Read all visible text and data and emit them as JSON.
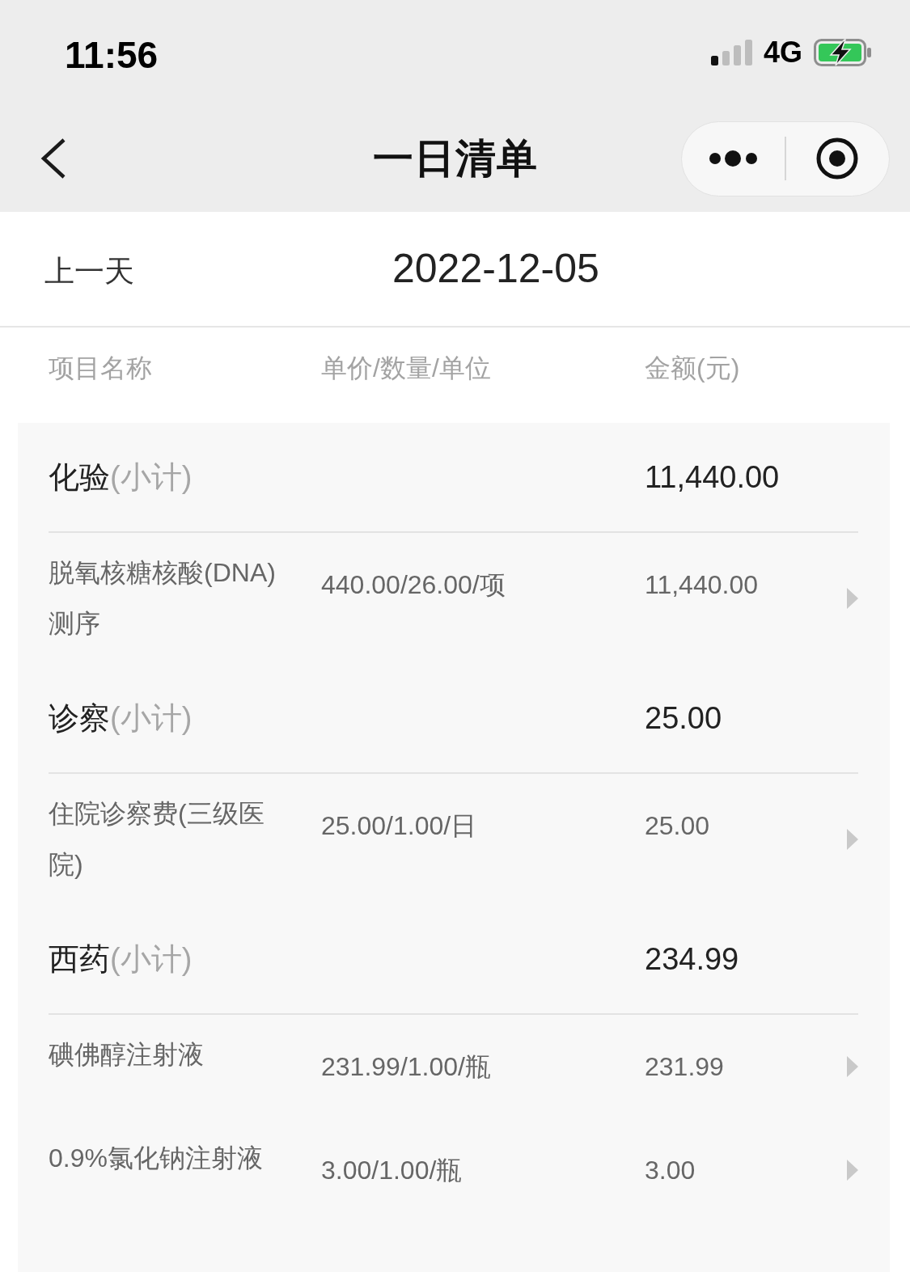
{
  "status_bar": {
    "time": "11:56",
    "network": "4G"
  },
  "nav_bar": {
    "title": "一日清单"
  },
  "date_bar": {
    "previous": "上一天",
    "date": "2022-12-05"
  },
  "table": {
    "columns": [
      "项目名称",
      "单价/数量/单位",
      "金额(元)"
    ],
    "groups": [
      {
        "category": "化验",
        "suffix": "(小计)",
        "amount": "11,440.00",
        "items": [
          {
            "name": "脱氧核糖核酸(DNA)测序",
            "unit_price": "440.00/26.00/项",
            "amount": "11,440.00"
          }
        ]
      },
      {
        "category": "诊察",
        "suffix": "(小计)",
        "amount": "25.00",
        "items": [
          {
            "name": "住院诊察费(三级医院)",
            "unit_price": "25.00/1.00/日",
            "amount": "25.00"
          }
        ]
      },
      {
        "category": "西药",
        "suffix": "(小计)",
        "amount": "234.99",
        "items": [
          {
            "name": "碘佛醇注射液",
            "unit_price": "231.99/1.00/瓶",
            "amount": "231.99"
          },
          {
            "name": "0.9%氯化钠注射液",
            "unit_price": "3.00/1.00/瓶",
            "amount": "3.00"
          }
        ]
      }
    ]
  }
}
